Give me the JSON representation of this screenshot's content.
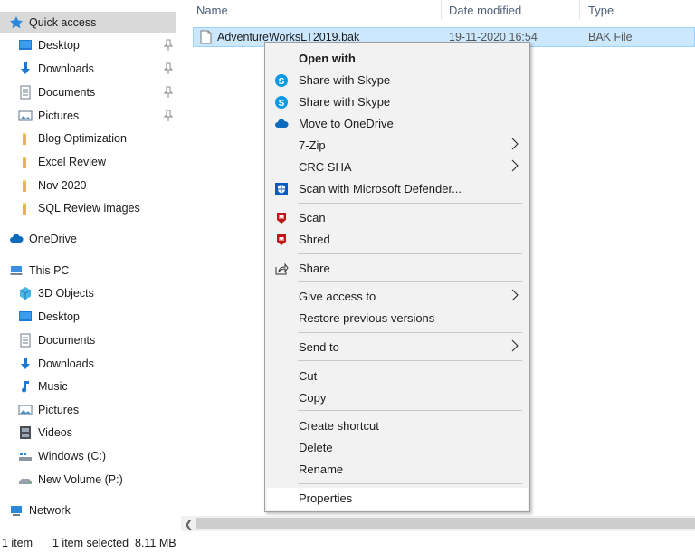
{
  "nav": {
    "items": [
      {
        "label": "Quick access",
        "icon": "star-icon",
        "pinned": false,
        "indent": false,
        "selected": true
      },
      {
        "label": "Desktop",
        "icon": "desktop-icon",
        "pinned": true,
        "indent": true
      },
      {
        "label": "Downloads",
        "icon": "download-icon",
        "pinned": true,
        "indent": true
      },
      {
        "label": "Documents",
        "icon": "document-icon",
        "pinned": true,
        "indent": true
      },
      {
        "label": "Pictures",
        "icon": "pictures-icon",
        "pinned": true,
        "indent": true
      },
      {
        "label": "Blog Optimization",
        "icon": "folder-icon",
        "pinned": false,
        "indent": true
      },
      {
        "label": "Excel Review",
        "icon": "folder-icon",
        "pinned": false,
        "indent": true
      },
      {
        "label": "Nov 2020",
        "icon": "folder-icon",
        "pinned": false,
        "indent": true
      },
      {
        "label": "SQL Review images",
        "icon": "folder-icon",
        "pinned": false,
        "indent": true
      },
      {
        "label": "OneDrive",
        "icon": "cloud-icon",
        "pinned": false,
        "indent": false
      },
      {
        "label": "This PC",
        "icon": "computer-icon",
        "pinned": false,
        "indent": false
      },
      {
        "label": "3D Objects",
        "icon": "cube-icon",
        "pinned": false,
        "indent": true
      },
      {
        "label": "Desktop",
        "icon": "desktop-icon",
        "pinned": false,
        "indent": true
      },
      {
        "label": "Documents",
        "icon": "document-icon",
        "pinned": false,
        "indent": true
      },
      {
        "label": "Downloads",
        "icon": "download-icon",
        "pinned": false,
        "indent": true
      },
      {
        "label": "Music",
        "icon": "music-icon",
        "pinned": false,
        "indent": true
      },
      {
        "label": "Pictures",
        "icon": "pictures-icon",
        "pinned": false,
        "indent": true
      },
      {
        "label": "Videos",
        "icon": "video-icon",
        "pinned": false,
        "indent": true
      },
      {
        "label": "Windows (C:)",
        "icon": "drive-c-icon",
        "pinned": false,
        "indent": true
      },
      {
        "label": "New Volume (P:)",
        "icon": "drive-icon",
        "pinned": false,
        "indent": true
      },
      {
        "label": "Network",
        "icon": "network-icon",
        "pinned": false,
        "indent": false
      }
    ]
  },
  "columns": {
    "name": "Name",
    "date_modified": "Date modified",
    "type": "Type"
  },
  "files": [
    {
      "name": "AdventureWorksLT2019.bak",
      "date": "19-11-2020 16:54",
      "type": "BAK File",
      "icon": "file-icon"
    }
  ],
  "context_menu": {
    "items": [
      {
        "label": "Open with",
        "bold": true
      },
      {
        "label": "Share with Skype",
        "icon": "skype-icon"
      },
      {
        "label": "Share with Skype",
        "icon": "skype-icon"
      },
      {
        "label": "Move to OneDrive",
        "icon": "onedrive-icon"
      },
      {
        "label": "7-Zip",
        "submenu": true
      },
      {
        "label": "CRC SHA",
        "submenu": true
      },
      {
        "label": "Scan with Microsoft Defender...",
        "icon": "defender-icon"
      },
      {
        "label": "Scan",
        "icon": "mcafee-icon"
      },
      {
        "label": "Shred",
        "icon": "mcafee-icon"
      },
      {
        "label": "Share",
        "icon": "share-icon"
      },
      {
        "label": "Give access to",
        "submenu": true
      },
      {
        "label": "Restore previous versions"
      },
      {
        "label": "Send to",
        "submenu": true
      },
      {
        "label": "Cut"
      },
      {
        "label": "Copy"
      },
      {
        "label": "Create shortcut"
      },
      {
        "label": "Delete"
      },
      {
        "label": "Rename"
      },
      {
        "label": "Properties",
        "hover": true
      }
    ]
  },
  "status": {
    "item_count": "1 item",
    "selection": "1 item selected  8.11 MB"
  },
  "colors": {
    "selection_bg": "#cce8ff",
    "accent": "#0078d7",
    "folder": "#e8b54b",
    "mcafee": "#c01818"
  }
}
